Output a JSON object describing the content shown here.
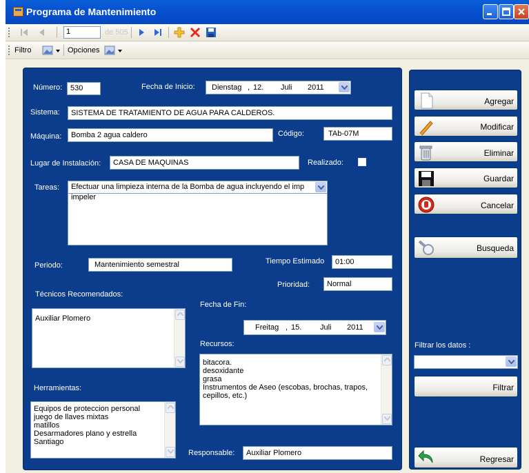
{
  "window": {
    "title": "Programa de Mantenimiento"
  },
  "nav_toolbar": {
    "position": "1",
    "count_label": "de 505"
  },
  "filter_toolbar": {
    "filter_label": "Filtro",
    "options_label": "Opciones"
  },
  "form": {
    "numero_label": "Número:",
    "numero_value": "530",
    "fecha_inicio_label": "Fecha de Inicio:",
    "fecha_inicio": {
      "day_name": "Dienstag",
      "sep1": ",",
      "day": "12.",
      "month": "Juli",
      "year": "2011"
    },
    "sistema_label": "Sistema:",
    "sistema_value": "SISTEMA DE TRATAMIENTO DE AGUA PARA CALDEROS.",
    "maquina_label": "Máquina:",
    "maquina_value": "Bomba 2 agua caldero",
    "codigo_label": "Código:",
    "codigo_value": "TAb-07M",
    "lugar_label": "Lugar de Instalación:",
    "lugar_value": "CASA DE MAQUINAS",
    "realizado_label": "Realizado:",
    "tareas_label": "Tareas:",
    "tareas_selected": "Efectuar una limpieza interna de la Bomba de agua incluyendo el imp",
    "tareas_text": "impeler",
    "periodo_label": "Periodo:",
    "periodo_value": "Mantenimiento semestral",
    "tiempo_label": "Tiempo Estimado",
    "tiempo_value": "01:00",
    "prioridad_label": "Prioridad:",
    "prioridad_value": "Normal",
    "tecnicos_label": "Técnicos Recomendados:",
    "tecnicos_items": [
      "Auxiliar Plomero"
    ],
    "fecha_fin_label": "Fecha de Fin:",
    "fecha_fin": {
      "day_name": "Freitag",
      "sep1": ",",
      "day": "15.",
      "month": "Juli",
      "year": "2011"
    },
    "recursos_label": "Recursos:",
    "recursos_items": [
      "bitacora.",
      "desoxidante",
      "grasa",
      "Instrumentos de Aseo (escobas, brochas, trapos,",
      "cepillos, etc.)"
    ],
    "herramientas_label": "Herramientas:",
    "herramientas_items": [
      "Equipos de proteccion personal",
      "juego de llaves mixtas",
      "matillos",
      "Desarmadores plano y estrella",
      "Santiago"
    ],
    "responsable_label": "Responsable:",
    "responsable_value": "Auxiliar Plomero"
  },
  "sidebar": {
    "agregar": "Agregar",
    "modificar": "Modificar",
    "eliminar": "Eliminar",
    "guardar": "Guardar",
    "cancelar": "Cancelar",
    "busqueda": "Busqueda",
    "filtrar_label": "Filtrar los datos :",
    "filtrar_value": "",
    "filtrar_button": "Filtrar",
    "regresar": "Regresar"
  },
  "colors": {
    "titlebar": "#0a5fd6",
    "panel": "#0c3d8c",
    "label_text": "#ffffff"
  }
}
